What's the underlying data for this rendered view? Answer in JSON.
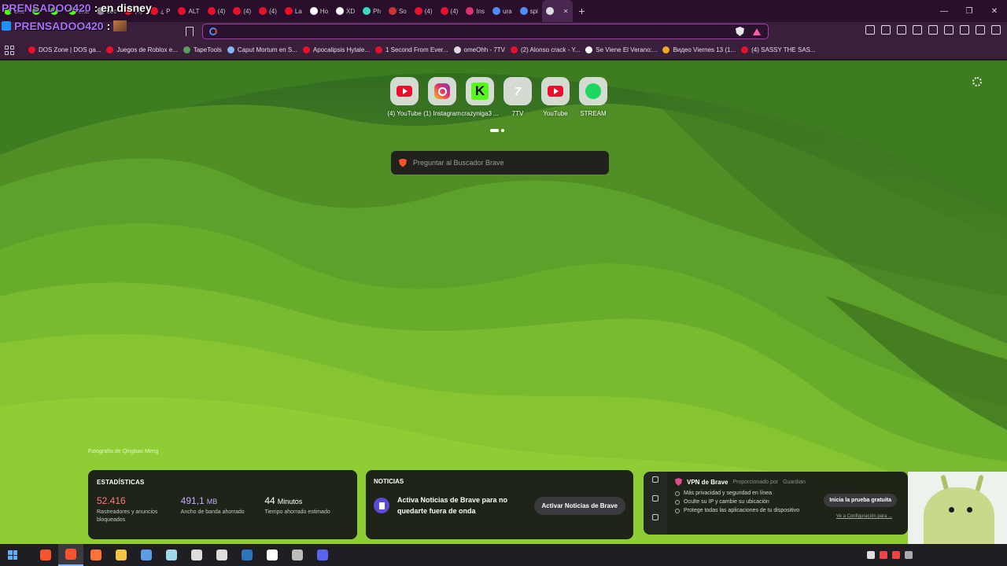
{
  "overlay": {
    "line1_name": "PRENSADOO420",
    "line1_text": ": en disney",
    "line2_name": "PRENSADOO420",
    "line2_text": ":"
  },
  "tabs": [
    {
      "label": "chu",
      "color": "#53fc18"
    },
    {
      "label": "",
      "color": "#53fc18"
    },
    {
      "label": "",
      "color": "#53fc18"
    },
    {
      "label": "ima",
      "color": "#53fc18"
    },
    {
      "label": "coc",
      "color": "#888888"
    },
    {
      "label": "(4)",
      "color": "#e8102b"
    },
    {
      "label": "¿ P",
      "color": "#e8102b"
    },
    {
      "label": "ALT",
      "color": "#e8102b"
    },
    {
      "label": "(4)",
      "color": "#e8102b"
    },
    {
      "label": "(4)",
      "color": "#e8102b"
    },
    {
      "label": "(4)",
      "color": "#e8102b"
    },
    {
      "label": "La",
      "color": "#e8102b"
    },
    {
      "label": "Ho",
      "color": "#ffffff"
    },
    {
      "label": "XD",
      "color": "#ffffff"
    },
    {
      "label": "Ph",
      "color": "#3dd6c4"
    },
    {
      "label": "So",
      "color": "#cc3333"
    },
    {
      "label": "(4)",
      "color": "#e8102b"
    },
    {
      "label": "(4)",
      "color": "#e8102b"
    },
    {
      "label": "Ins",
      "color": "#e1306c"
    },
    {
      "label": "ura",
      "color": "#4f8df5"
    },
    {
      "label": "spi",
      "color": "#4f8df5"
    },
    {
      "label": "",
      "color": "#dddddd",
      "active": true
    }
  ],
  "window_controls": {
    "minimize": "—",
    "restore": "❐",
    "close": "✕"
  },
  "bookmarks": [
    {
      "label": "DOS Zone | DOS ga...",
      "color": "#e8102b"
    },
    {
      "label": "Juegos de Roblox e...",
      "color": "#e8102b"
    },
    {
      "label": "TapeTools",
      "color": "#5aa05a"
    },
    {
      "label": "Caput Mortum en S...",
      "color": "#8ab4f8"
    },
    {
      "label": "Apocalipsis Hytale...",
      "color": "#e8102b"
    },
    {
      "label": "1 Second From Ever...",
      "color": "#e8102b"
    },
    {
      "label": "omeOhh - 7TV",
      "color": "#dddddd"
    },
    {
      "label": "(2) Alonso crack - Y...",
      "color": "#e8102b"
    },
    {
      "label": "Se Viene El Verano:...",
      "color": "#ffffff"
    },
    {
      "label": "Видео Viernes 13 (1...",
      "color": "#f5a623"
    },
    {
      "label": "(4) SASSY THE SAS...",
      "color": "#e8102b"
    }
  ],
  "topsites": [
    {
      "label": "(4) YouTube",
      "icon": "youtube-icon"
    },
    {
      "label": "(1) Instagram",
      "icon": "instagram-icon"
    },
    {
      "label": "crazyniga3 ...",
      "icon": "kick-icon"
    },
    {
      "label": "7TV",
      "icon": "7tv-icon"
    },
    {
      "label": "YouTube",
      "icon": "youtube-icon"
    },
    {
      "label": "STREAM",
      "icon": "spotify-icon"
    }
  ],
  "search": {
    "placeholder": "Preguntar al Buscador Brave"
  },
  "photo_credit": "Fotografía de Qingbao Meng",
  "stats": {
    "title": "ESTADÍSTICAS",
    "items": [
      {
        "value": "52.416",
        "unit": "",
        "desc": "Rastreadores y anuncios bloqueados",
        "color": "#ff7a7a"
      },
      {
        "value": "491,1",
        "unit": "MB",
        "desc": "Ancho de banda ahorrado",
        "color": "#c8a8ff"
      },
      {
        "value": "44",
        "unit": "Minutos",
        "desc": "Tiempo ahorrado estimado",
        "color": "#ffffff"
      }
    ]
  },
  "news": {
    "title": "NOTICIAS",
    "text": "Activa Noticias de Brave para no quedarte fuera de onda",
    "button": "Activar Noticias de Brave"
  },
  "vpn": {
    "title": "VPN de Brave",
    "provider": "Proporcionado por",
    "provider_name": "Guardian",
    "features": [
      "Más privacidad y seguridad en línea",
      "Oculte su IP y cambie su ubicación",
      "Protege todas las aplicaciones de tu dispositivo"
    ],
    "trial_button": "Inicia la prueba gratuita",
    "config_link": "Ve a Configuración para ..."
  },
  "taskbar": {
    "apps": [
      {
        "name": "brave-icon",
        "color": "#fb542b"
      },
      {
        "name": "brave-active-icon",
        "color": "#fb542b",
        "active": true
      },
      {
        "name": "firefox-icon",
        "color": "#ff7139"
      },
      {
        "name": "file-explorer-icon",
        "color": "#f5c542"
      },
      {
        "name": "calculator-icon",
        "color": "#5c9de8"
      },
      {
        "name": "sticky-icon",
        "color": "#9fd8e8"
      },
      {
        "name": "app-icon",
        "color": "#dddddd"
      },
      {
        "name": "app2-icon",
        "color": "#dddddd"
      },
      {
        "name": "steam-icon",
        "color": "#2a75bb"
      },
      {
        "name": "obs-icon",
        "color": "#ffffff"
      },
      {
        "name": "app3-icon",
        "color": "#bbbbbb"
      },
      {
        "name": "discord-icon",
        "color": "#5865f2"
      }
    ]
  }
}
